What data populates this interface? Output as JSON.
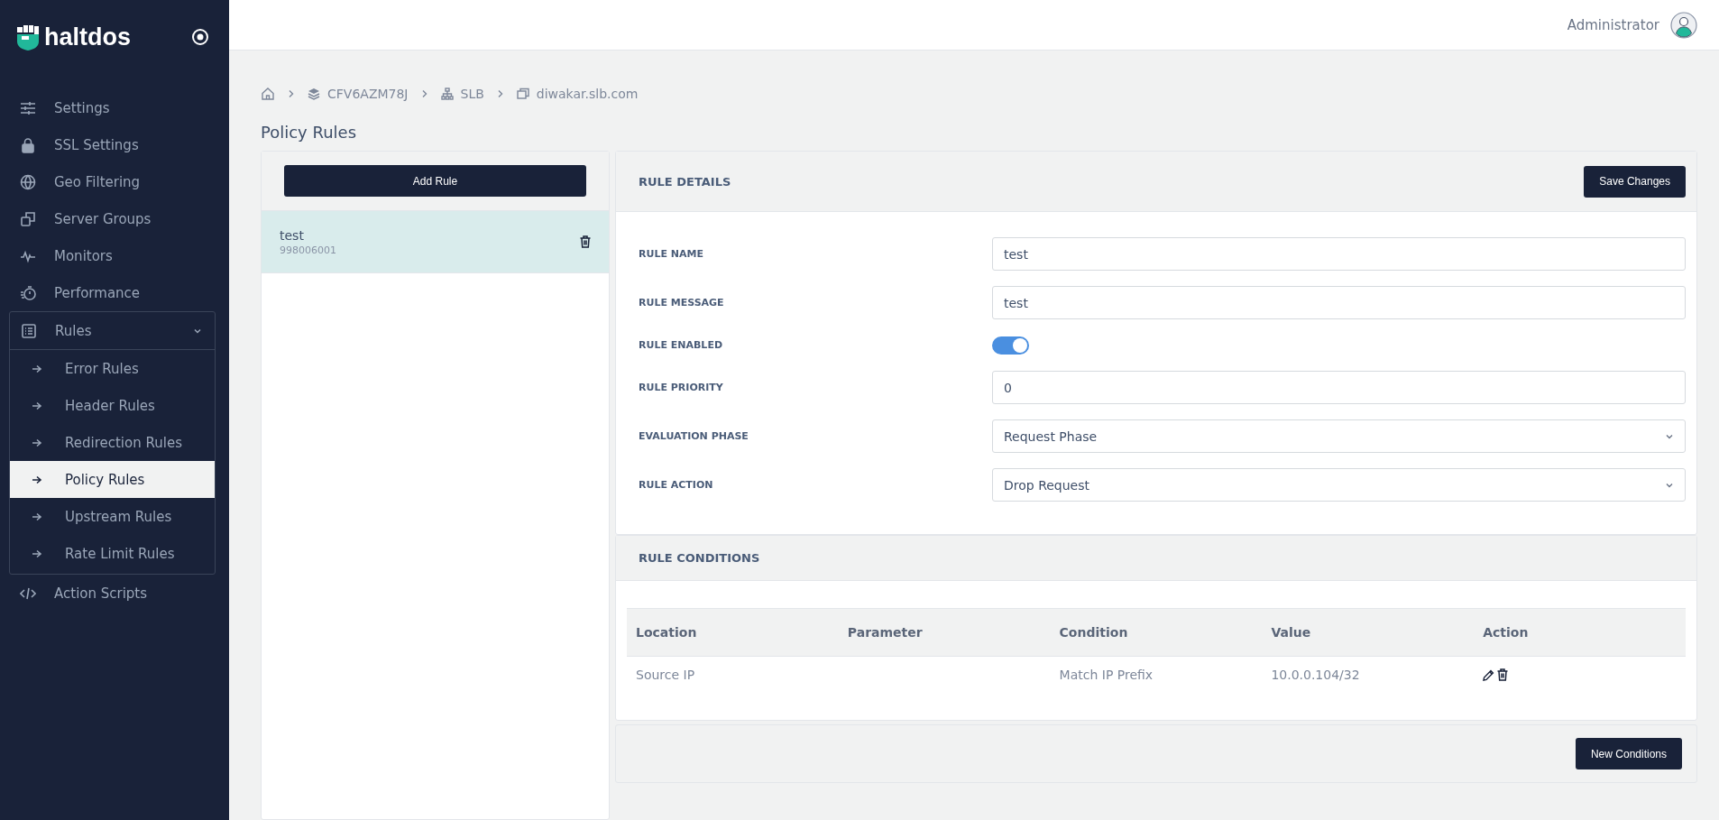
{
  "brand": {
    "name": "haltdos"
  },
  "sidebar": {
    "items": [
      {
        "label": "Settings"
      },
      {
        "label": "SSL Settings"
      },
      {
        "label": "Geo Filtering"
      },
      {
        "label": "Server Groups"
      },
      {
        "label": "Monitors"
      },
      {
        "label": "Performance"
      },
      {
        "label": "Rules",
        "expanded": true,
        "children": [
          {
            "label": "Error Rules",
            "selected": false
          },
          {
            "label": "Header Rules",
            "selected": false
          },
          {
            "label": "Redirection Rules",
            "selected": false
          },
          {
            "label": "Policy Rules",
            "selected": true
          },
          {
            "label": "Upstream Rules",
            "selected": false
          },
          {
            "label": "Rate Limit Rules",
            "selected": false
          }
        ]
      },
      {
        "label": "Action Scripts"
      }
    ]
  },
  "header": {
    "user": "Administrator"
  },
  "breadcrumb": [
    "CFV6AZM78J",
    "SLB",
    "diwakar.slb.com"
  ],
  "page_title": "Policy Rules",
  "rules_list": {
    "add_button": "Add Rule",
    "items": [
      {
        "name": "test",
        "id": "998006001",
        "selected": true
      }
    ]
  },
  "rule_details": {
    "title": "RULE DETAILS",
    "save_button": "Save Changes",
    "fields": [
      {
        "label": "RULE NAME",
        "kind": "text",
        "value": "test"
      },
      {
        "label": "RULE MESSAGE",
        "kind": "text",
        "value": "test"
      },
      {
        "label": "RULE ENABLED",
        "kind": "toggle",
        "on": true
      },
      {
        "label": "RULE PRIORITY",
        "kind": "text",
        "value": "0"
      },
      {
        "label": "EVALUATION PHASE",
        "kind": "select",
        "value": "Request Phase"
      },
      {
        "label": "RULE ACTION",
        "kind": "select",
        "value": "Drop Request"
      }
    ]
  },
  "rule_conditions": {
    "title": "RULE CONDITIONS",
    "columns": [
      "Location",
      "Parameter",
      "Condition",
      "Value",
      "Action"
    ],
    "rows": [
      {
        "location": "Source IP",
        "parameter": "",
        "condition": "Match IP Prefix",
        "value": "10.0.0.104/32"
      }
    ],
    "new_button": "New Conditions"
  }
}
